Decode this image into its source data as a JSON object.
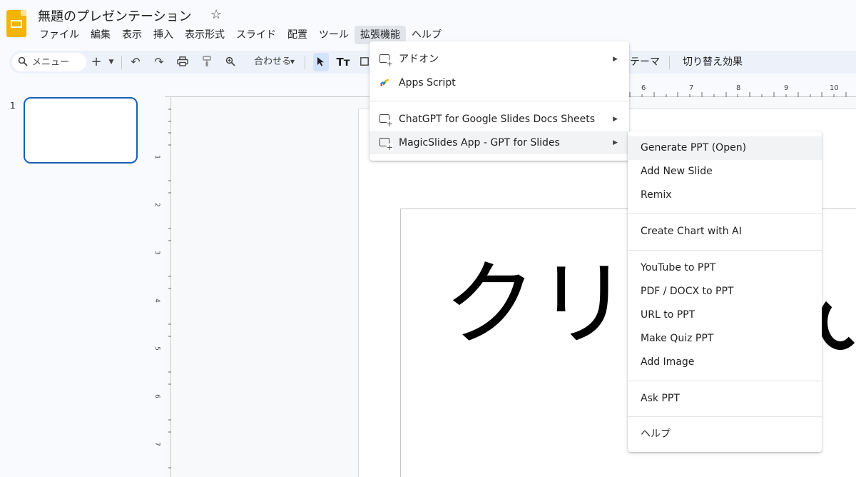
{
  "header": {
    "doc_title": "無題のプレゼンテーション",
    "star": "☆"
  },
  "menubar": [
    "ファイル",
    "編集",
    "表示",
    "挿入",
    "表示形式",
    "スライド",
    "配置",
    "ツール",
    "拡張機能",
    "ヘルプ"
  ],
  "toolbar": {
    "search_label": "メニュー",
    "zoom_label": "合わせる",
    "theme_label": "テーマ",
    "transition_label": "切り替え効果"
  },
  "filmstrip": {
    "slide_number": "1"
  },
  "ruler": {
    "top_numbers": [
      "6",
      "7",
      "8",
      "9",
      "10"
    ],
    "left_numbers": [
      "1",
      "2",
      "3",
      "4",
      "5",
      "6",
      "7"
    ]
  },
  "slide": {
    "visible_text": "クリ"
  },
  "extensions_menu": {
    "items": [
      {
        "label": "アドオン",
        "has_submenu": true
      },
      {
        "label": "Apps Script",
        "has_submenu": false
      },
      {
        "label": "ChatGPT for Google Slides Docs Sheets",
        "has_submenu": true
      },
      {
        "label": "MagicSlides App - GPT for Slides",
        "has_submenu": true
      }
    ]
  },
  "magicslides_submenu": {
    "items": [
      "Generate PPT (Open)",
      "Add New Slide",
      "Remix",
      "Create Chart with AI",
      "YouTube to PPT",
      "PDF / DOCX to PPT",
      "URL to PPT",
      "Make Quiz PPT",
      "Add Image",
      "Ask PPT",
      "ヘルプ"
    ]
  }
}
